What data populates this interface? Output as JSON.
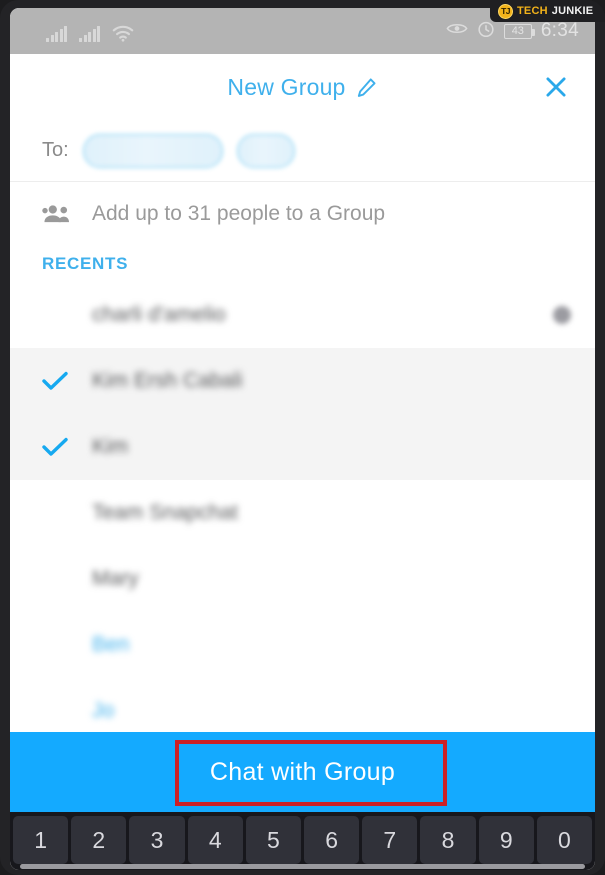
{
  "watermark": {
    "badge": "TJ",
    "text_primary": "TECH",
    "text_secondary": "JUNKIE"
  },
  "status_bar": {
    "icons": [
      "signal-bars-icon",
      "signal-bars-icon",
      "wifi-icon",
      "eye-icon",
      "alarm-clock-icon"
    ],
    "battery_level": "43",
    "time": "6:34"
  },
  "header": {
    "title": "New Group",
    "edit_icon": "pencil-icon",
    "close_icon": "close-icon",
    "accent_color": "#3fb0ec"
  },
  "to_row": {
    "label": "To:",
    "chips": [
      {
        "name": "recipient-chip-1",
        "redacted": true
      },
      {
        "name": "recipient-chip-2",
        "redacted": true
      }
    ]
  },
  "add_people": {
    "icon": "people-group-icon",
    "label": "Add up to 31 people to a Group",
    "max_people": 31
  },
  "recents": {
    "header": "RECENTS",
    "rows": [
      {
        "name": "",
        "redacted": true,
        "selected": false,
        "checked": false,
        "badge": true,
        "accent": false
      },
      {
        "name": "",
        "redacted": true,
        "selected": true,
        "checked": true,
        "badge": false,
        "accent": false
      },
      {
        "name": "",
        "redacted": true,
        "selected": true,
        "checked": true,
        "badge": false,
        "accent": false
      },
      {
        "name": "",
        "redacted": true,
        "selected": false,
        "checked": false,
        "badge": false,
        "accent": false
      },
      {
        "name": "",
        "redacted": true,
        "selected": false,
        "checked": false,
        "badge": false,
        "accent": false
      },
      {
        "name": "",
        "redacted": true,
        "selected": false,
        "checked": false,
        "badge": false,
        "accent": true
      },
      {
        "name": "",
        "redacted": true,
        "selected": false,
        "checked": false,
        "badge": false,
        "accent": true
      }
    ]
  },
  "chat_bar": {
    "button_label": "Chat with Group",
    "background_color": "#14aaff",
    "annotation_color": "#cc2026"
  },
  "keyboard": {
    "keys": [
      "1",
      "2",
      "3",
      "4",
      "5",
      "6",
      "7",
      "8",
      "9",
      "0"
    ]
  }
}
